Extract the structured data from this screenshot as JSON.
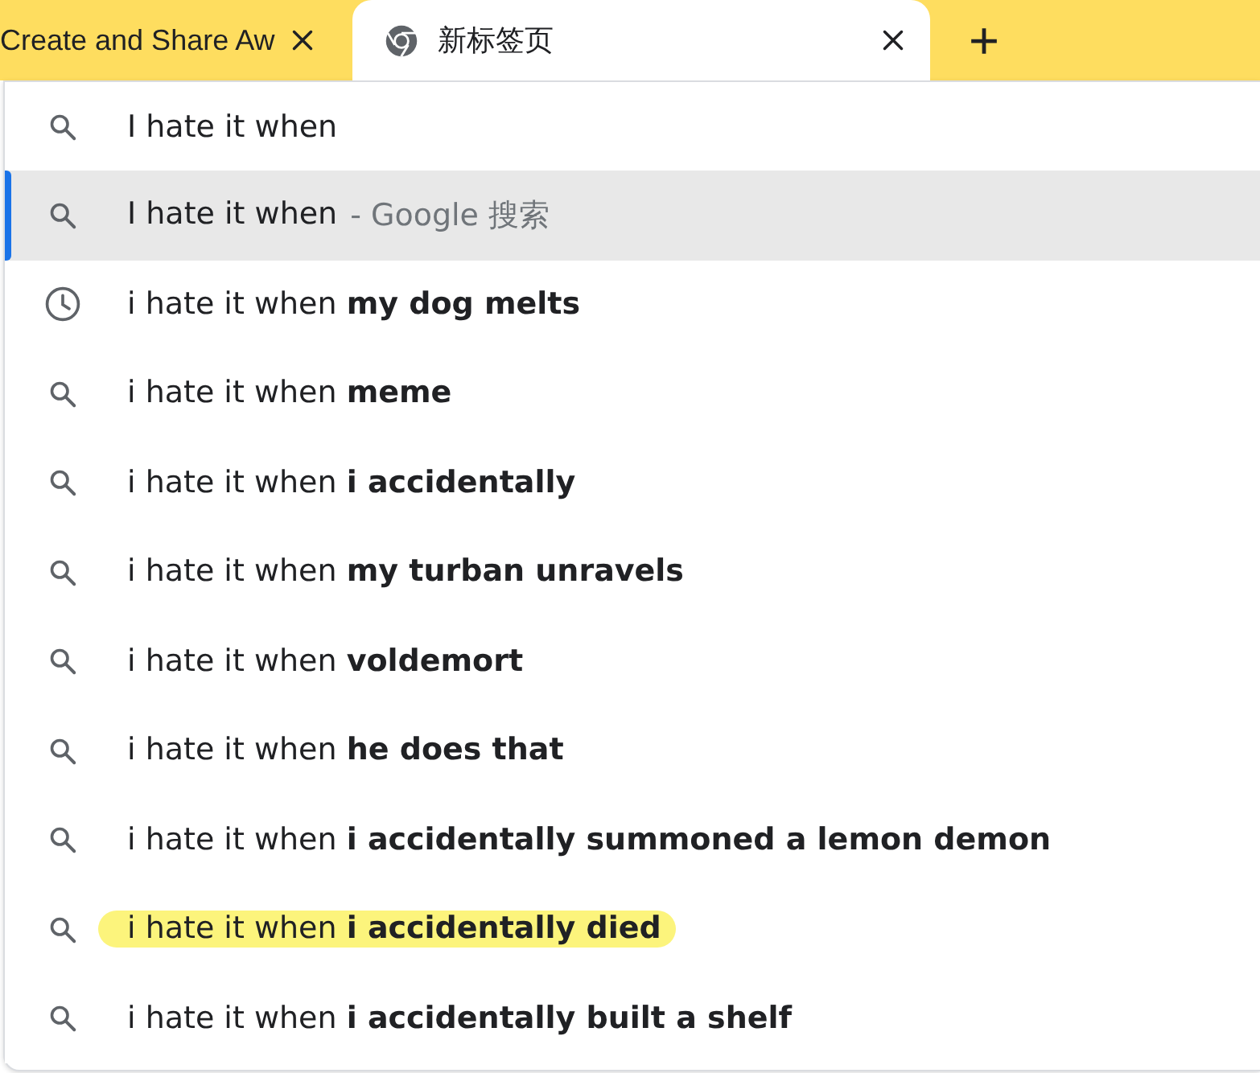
{
  "tabs": [
    {
      "title": "Create and Share Aw",
      "selected": false,
      "favicon": false
    },
    {
      "title": "新标签页",
      "selected": true,
      "favicon": true
    }
  ],
  "omnibox": {
    "value": "I hate it when"
  },
  "suggestions": [
    {
      "kind": "search",
      "text": "I hate it when",
      "suffix": "- Google 搜索",
      "selected": true,
      "highlighted": false
    },
    {
      "kind": "history",
      "text": "i hate it when **my dog melts**",
      "selected": false,
      "highlighted": false
    },
    {
      "kind": "search",
      "text": "i hate it when **meme**",
      "selected": false,
      "highlighted": false
    },
    {
      "kind": "search",
      "text": "i hate it when **i accidentally**",
      "selected": false,
      "highlighted": false
    },
    {
      "kind": "search",
      "text": "i hate it when **my turban unravels**",
      "selected": false,
      "highlighted": false
    },
    {
      "kind": "search",
      "text": "i hate it when **voldemort**",
      "selected": false,
      "highlighted": false
    },
    {
      "kind": "search",
      "text": "i hate it when **he does that**",
      "selected": false,
      "highlighted": false
    },
    {
      "kind": "search",
      "text": "i hate it when **i accidentally summoned a lemon demon**",
      "selected": false,
      "highlighted": false
    },
    {
      "kind": "search",
      "text": "i hate it when **i accidentally died**",
      "selected": false,
      "highlighted": true
    },
    {
      "kind": "search",
      "text": "i hate it when **i accidentally built a shelf**",
      "selected": false,
      "highlighted": false
    }
  ]
}
